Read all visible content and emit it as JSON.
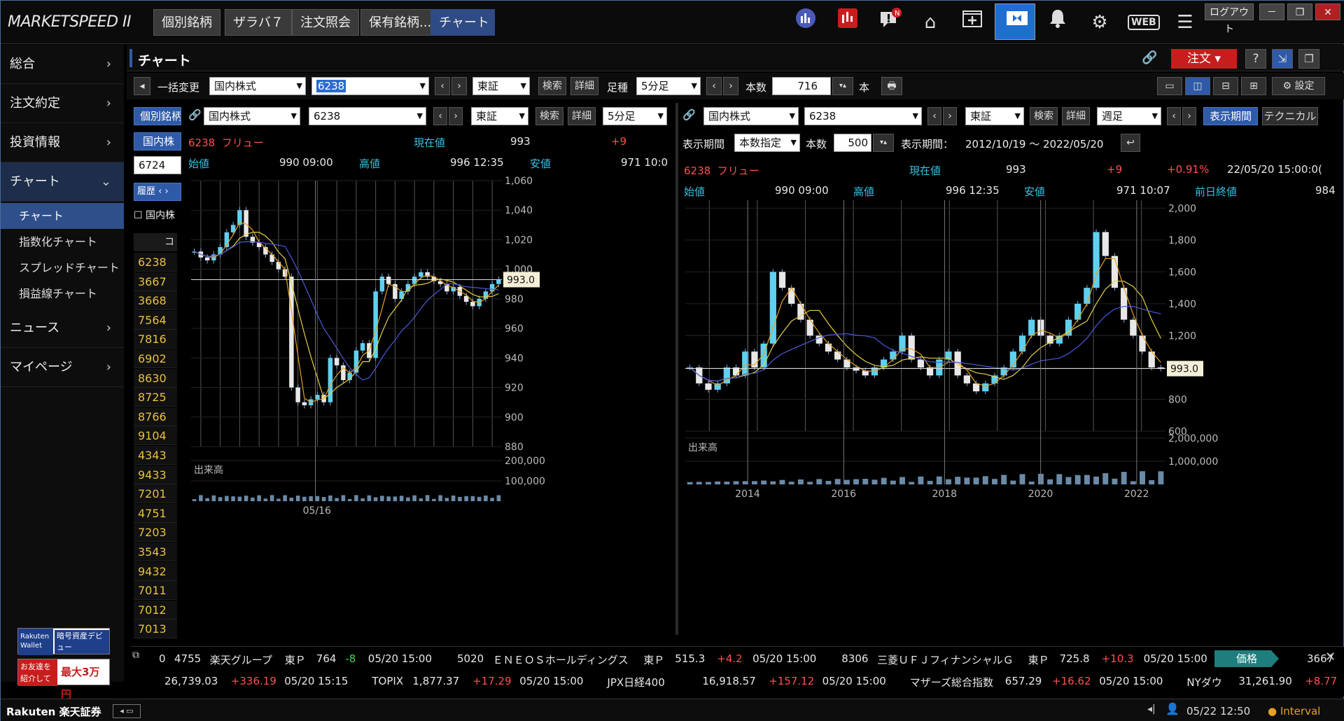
{
  "app": {
    "logo": "MARKETSPEED II"
  },
  "top_tabs": [
    "個別銘柄",
    "ザラバ７",
    "注文照会",
    "保有銘柄...",
    "チャート"
  ],
  "window_controls": {
    "logout": "ログアウト",
    "minimize": "－",
    "restore": "❐",
    "close": "✕"
  },
  "top_icons": [
    "market-icon",
    "ranking-icon",
    "news-icon",
    "home-icon",
    "add-window-icon",
    "screen-icon",
    "bell-icon",
    "settings-icon",
    "web-icon",
    "menu-icon"
  ],
  "top_icon_labels": {
    "web": "WEB",
    "news_badge": "N"
  },
  "sidebar": {
    "items": [
      {
        "label": "総合"
      },
      {
        "label": "注文約定"
      },
      {
        "label": "投資情報"
      },
      {
        "label": "チャート"
      },
      {
        "label": "ニュース"
      },
      {
        "label": "マイページ"
      }
    ],
    "chart_sub": [
      "チャート",
      "指数化チャート",
      "スプレッドチャート",
      "損益線チャート"
    ]
  },
  "banners": {
    "b1a": "Rakuten Wallet",
    "b1b": "暗号資産デビュー",
    "b2a": "お友達を紹介して",
    "b2b": "最大3万円"
  },
  "header": {
    "title": "チャート",
    "order": "注文",
    "help": "?",
    "settings": "設定"
  },
  "toolbar": {
    "bulk_change": "一括変更",
    "market": "国内株式",
    "code": "6238",
    "exchange": "東証",
    "search": "検索",
    "detail": "詳細",
    "ashi_label": "足種",
    "ashi": "5分足",
    "count_label": "本数",
    "count": "716",
    "count_unit": "本"
  },
  "watch": {
    "tab": "個別銘柄",
    "market": "国内株",
    "code_input": "6724",
    "history": "履歴",
    "checkbox_label": "国内株",
    "col_header": "コ",
    "codes": [
      "6238",
      "3667",
      "3668",
      "7564",
      "7816",
      "6902",
      "8630",
      "8725",
      "8766",
      "9104",
      "4343",
      "9433",
      "7201",
      "4751",
      "7203",
      "3543",
      "9432",
      "7011",
      "7012",
      "7013"
    ]
  },
  "left_chart": {
    "toolbar": {
      "market": "国内株式",
      "code": "6238",
      "exchange": "東証",
      "search": "検索",
      "detail": "詳細",
      "ashi": "5分足"
    },
    "info": {
      "code": "6238",
      "name": "フリュー",
      "current_label": "現在値",
      "current": "993",
      "change": "+9",
      "open_label": "始値",
      "open": "990 09:00",
      "high_label": "高値",
      "high": "996 12:35",
      "low_label": "安値",
      "low": "971 10:0"
    },
    "price_label": "993.0",
    "volume_label": "出来高",
    "date_label": "05/16"
  },
  "right_chart": {
    "toolbar": {
      "market": "国内株式",
      "code": "6238",
      "exchange": "東証",
      "search": "検索",
      "detail": "詳細",
      "ashi": "週足",
      "period_btn": "表示期間",
      "tech_btn": "テクニカル"
    },
    "period": {
      "label": "表示期間",
      "mode": "本数指定",
      "count_label": "本数",
      "count": "500",
      "range_label": "表示期間：",
      "range": "2012/10/19 ～ 2022/05/20"
    },
    "info": {
      "code": "6238",
      "name": "フリュー",
      "current_label": "現在値",
      "current": "993",
      "change": "+9",
      "pct": "+0.91%",
      "date": "22/05/20 15:00:0(",
      "open_label": "始値",
      "open": "990 09:00",
      "high_label": "高値",
      "high": "996 12:35",
      "low_label": "安値",
      "low": "971 10:07",
      "prev_label": "前日終値",
      "prev": "984"
    },
    "price_label": "993.0",
    "volume_label": "出来高"
  },
  "chart_data": [
    {
      "type": "candlestick",
      "title": "6238 フリュー 5分足",
      "ylim": [
        880,
        1060
      ],
      "yticks": [
        "1,060",
        "1,040",
        "1,020",
        "1,000",
        "980",
        "960",
        "940",
        "920",
        "900",
        "880"
      ],
      "xticks": [
        "05/16"
      ],
      "close": [
        1012,
        1008,
        1006,
        1010,
        1015,
        1025,
        1030,
        1040,
        1022,
        1018,
        1015,
        1010,
        1005,
        1000,
        995,
        920,
        910,
        908,
        912,
        915,
        910,
        940,
        935,
        925,
        930,
        945,
        950,
        940,
        985,
        995,
        990,
        980,
        985,
        990,
        995,
        998,
        995,
        992,
        990,
        985,
        988,
        982,
        978,
        975,
        980,
        985,
        990,
        993
      ],
      "volume": {
        "ylim": [
          0,
          200000
        ],
        "yticks": [
          "200,000",
          "100,000"
        ]
      }
    },
    {
      "type": "candlestick",
      "title": "6238 フリュー 週足",
      "ylim": [
        600,
        2050
      ],
      "yticks": [
        "2,000",
        "1,800",
        "1,600",
        "1,400",
        "1,200",
        "1,000",
        "800",
        "600"
      ],
      "xticks": [
        "2014",
        "2016",
        "2018",
        "2020",
        "2022"
      ],
      "close": [
        1000,
        900,
        860,
        900,
        1000,
        950,
        1100,
        1000,
        1150,
        1600,
        1500,
        1400,
        1300,
        1200,
        1150,
        1100,
        1050,
        1000,
        980,
        950,
        1000,
        1050,
        1100,
        1200,
        1050,
        1000,
        950,
        1050,
        1100,
        950,
        900,
        850,
        900,
        950,
        1000,
        1100,
        1200,
        1300,
        1200,
        1150,
        1200,
        1300,
        1400,
        1500,
        1850,
        1700,
        1500,
        1300,
        1200,
        1100,
        1000,
        993
      ],
      "volume": {
        "ylim": [
          0,
          2000000
        ],
        "yticks": [
          "2,000,000",
          "1,000,000"
        ]
      }
    }
  ],
  "ticker": {
    "row1": [
      {
        "code": "4755",
        "name": "楽天グループ",
        "mkt": "東Ｐ",
        "price": "764",
        "chg": "-8",
        "time": "05/20 15:00"
      },
      {
        "code": "5020",
        "name": "ＥＮＥＯＳホールディングス",
        "mkt": "東Ｐ",
        "price": "515.3",
        "chg": "+4.2",
        "time": "05/20 15:00"
      },
      {
        "code": "8306",
        "name": "三菱ＵＦＪフィナンシャルＧ",
        "mkt": "東Ｐ",
        "price": "725.8",
        "chg": "+10.3",
        "time": "05/20 15:00"
      }
    ],
    "row1_lead": "0",
    "price_tag": "価格",
    "price_tag_val": "3667",
    "row2": [
      {
        "name": "",
        "price": "26,739.03",
        "chg": "+336.19",
        "time": "05/20 15:15"
      },
      {
        "name": "TOPIX",
        "price": "1,877.37",
        "chg": "+17.29",
        "time": "05/20 15:00"
      },
      {
        "name": "JPX日経400",
        "price": "16,918.57",
        "chg": "+157.12",
        "time": "05/20 15:00"
      },
      {
        "name": "マザーズ総合指数",
        "price": "657.29",
        "chg": "+16.62",
        "time": "05/20 15:00"
      },
      {
        "name": "NYダウ",
        "price": "31,261.90",
        "chg": "+8.77",
        "time": ""
      }
    ]
  },
  "status": {
    "brand": "Rakuten 楽天証券",
    "datetime": "05/22 12:50",
    "interval": "Interval"
  }
}
